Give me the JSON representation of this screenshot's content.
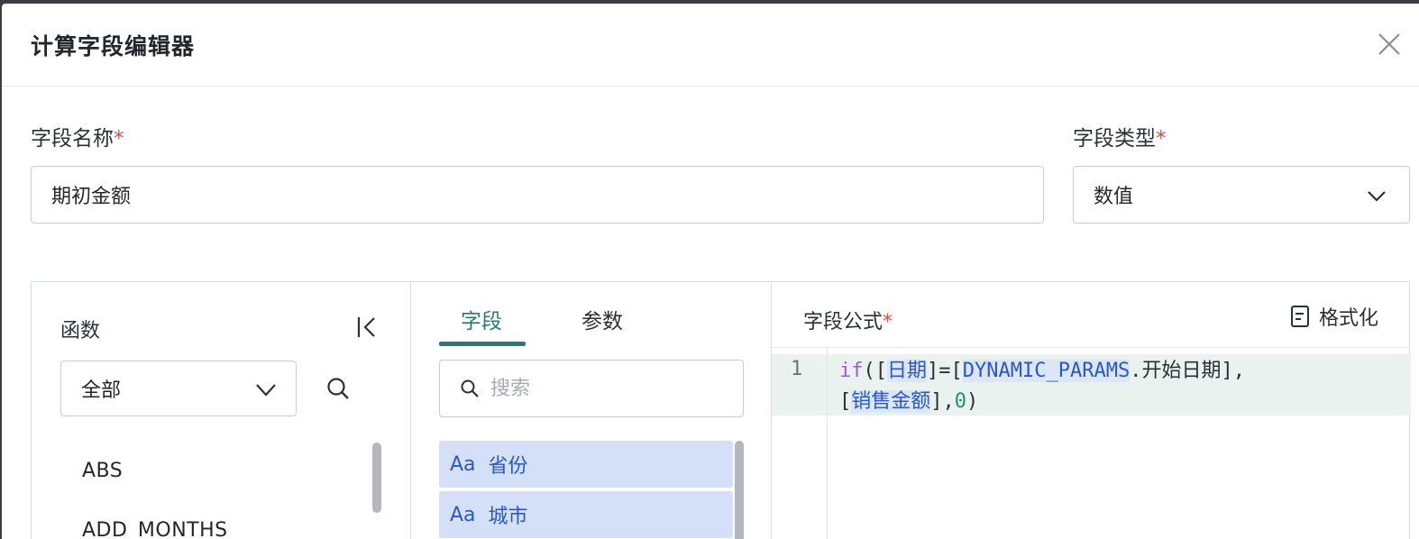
{
  "dialog": {
    "title": "计算字段编辑器"
  },
  "form": {
    "name_label": "字段名称",
    "name_value": "期初金额",
    "type_label": "字段类型",
    "type_value": "数值",
    "required_mark": "*"
  },
  "functions": {
    "label": "函数",
    "category_value": "全部",
    "items": [
      "ABS",
      "ADD_MONTHS"
    ]
  },
  "fields_panel": {
    "tabs": [
      {
        "label": "字段",
        "active": true
      },
      {
        "label": "参数",
        "active": false
      }
    ],
    "search_placeholder": "搜索",
    "type_prefix": "Aa",
    "items": [
      "省份",
      "城市"
    ]
  },
  "formula": {
    "label": "字段公式",
    "format_label": "格式化",
    "line_number": "1",
    "tokens": {
      "kw_if": "if",
      "p1": "([",
      "ref_date": "日期",
      "p2": "]=[",
      "ref_dyn": "DYNAMIC_PARAMS",
      "p3": ".开始日期],",
      "p4": "[",
      "ref_sales": "销售金额",
      "p5": "],",
      "num_zero": "0",
      "p6": ")"
    }
  },
  "colors": {
    "accent": "#2a7a6f",
    "required": "#e24b4b",
    "field_chip_bg": "#d3e0f7",
    "field_chip_text": "#2a58c8"
  }
}
